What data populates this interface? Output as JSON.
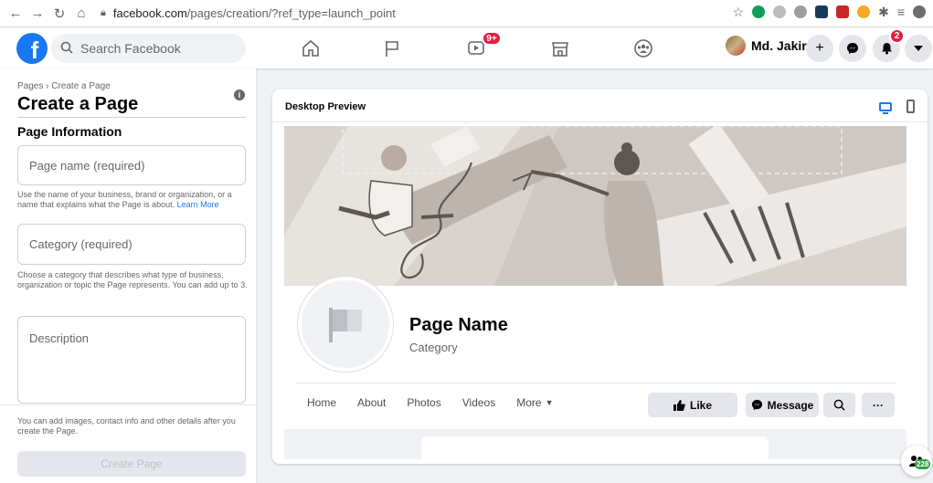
{
  "browser": {
    "host": "facebook.com",
    "path": "/pages/creation/?ref_type=launch_point"
  },
  "topbar": {
    "logo_letter": "f",
    "search_placeholder": "Search Facebook",
    "video_badge": "9+",
    "user_name": "Md. Jakir",
    "notif_badge": "2"
  },
  "left": {
    "breadcrumb": "Pages › Create a Page",
    "title": "Create a Page",
    "section": "Page Information",
    "name_placeholder": "Page name (required)",
    "name_help": "Use the name of your business, brand or organization, or a name that explains what the Page is about.",
    "learn_more": "Learn More",
    "category_placeholder": "Category (required)",
    "category_help": "Choose a category that describes what type of business, organization or topic the Page represents. You can add up to 3.",
    "description_placeholder": "Description",
    "footer_text": "You can add images, contact info and other details after you create the Page.",
    "create_button": "Create Page"
  },
  "preview": {
    "header": "Desktop Preview",
    "page_name": "Page Name",
    "category": "Category",
    "tabs": [
      "Home",
      "About",
      "Photos",
      "Videos",
      "More"
    ],
    "like": "Like",
    "message": "Message"
  },
  "chat": {
    "count": "228"
  },
  "colors": {
    "accent": "#1877f2",
    "badge": "#e41e3f",
    "online": "#31a24c"
  }
}
